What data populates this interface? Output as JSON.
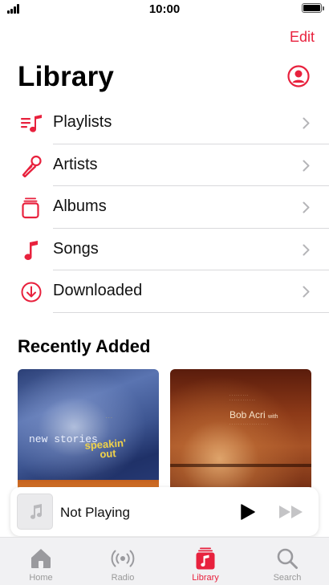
{
  "status_bar": {
    "time": "10:00"
  },
  "header": {
    "edit_label": "Edit",
    "title": "Library"
  },
  "menu": {
    "items": [
      {
        "label": "Playlists",
        "icon": "playlists-icon"
      },
      {
        "label": "Artists",
        "icon": "microphone-icon"
      },
      {
        "label": "Albums",
        "icon": "albums-icon"
      },
      {
        "label": "Songs",
        "icon": "music-note-icon"
      },
      {
        "label": "Downloaded",
        "icon": "download-icon"
      }
    ]
  },
  "recently_added": {
    "title": "Recently Added",
    "albums": [
      {
        "art_text_main": "new stories",
        "art_text_accent_1": "speakin'",
        "art_text_accent_2": "out"
      },
      {
        "art_text_main": "Bob Acri",
        "art_text_suffix": "with"
      }
    ]
  },
  "mini_player": {
    "title": "Not Playing"
  },
  "tab_bar": {
    "tabs": [
      {
        "label": "Home",
        "icon": "home-icon"
      },
      {
        "label": "Radio",
        "icon": "radio-icon"
      },
      {
        "label": "Library",
        "icon": "library-icon",
        "active": true
      },
      {
        "label": "Search",
        "icon": "search-icon"
      }
    ]
  },
  "colors": {
    "accent": "#e8213d",
    "inactive": "#999999",
    "divider": "#d9d9dc"
  }
}
